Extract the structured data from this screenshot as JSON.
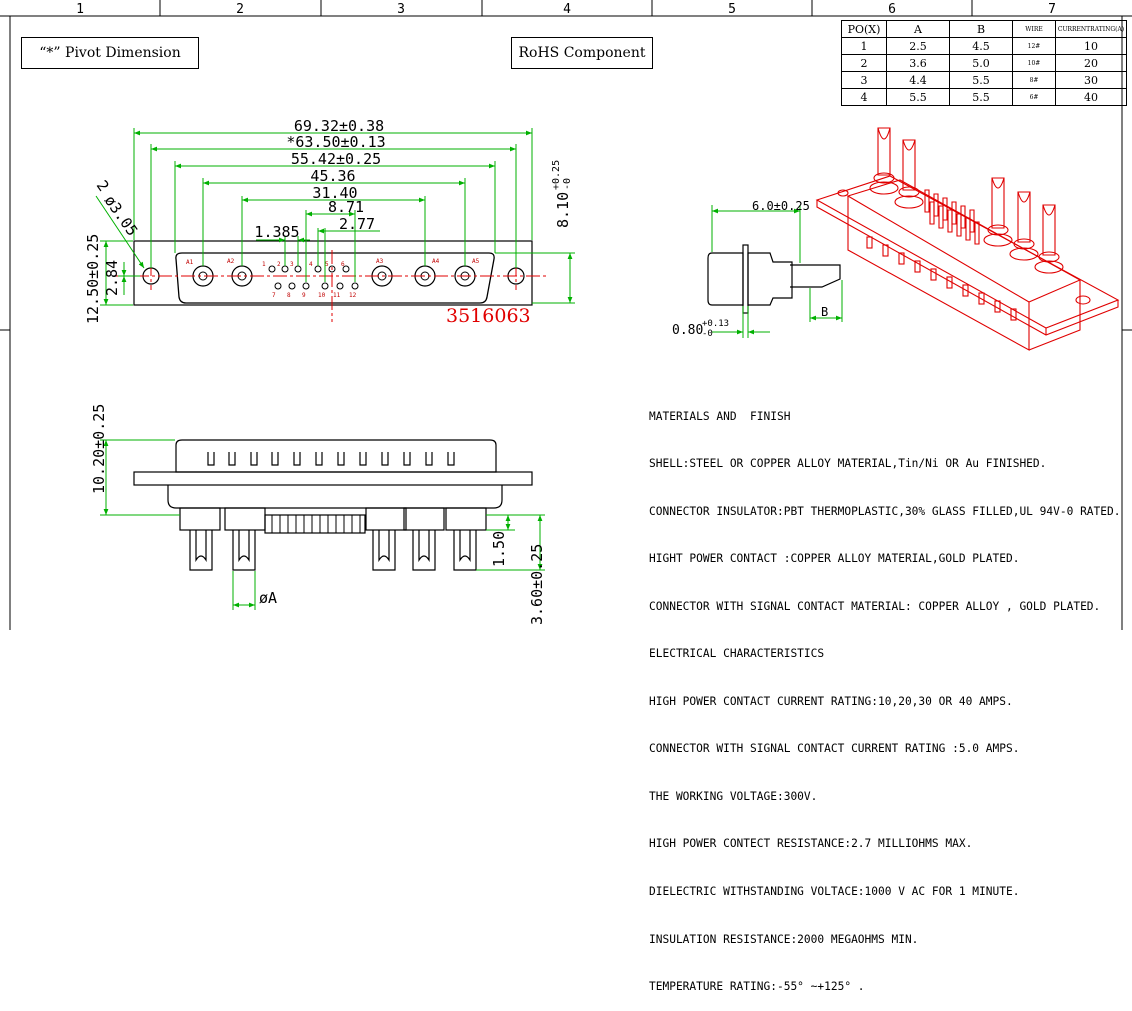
{
  "sheet": {
    "column_numbers": [
      "1",
      "2",
      "3",
      "4",
      "5",
      "6",
      "7"
    ]
  },
  "labels": {
    "pivot_dimension": "“*” Pivot Dimension",
    "rohs": "RoHS  Component"
  },
  "table": {
    "headers": [
      "PO(X)",
      "A",
      "B",
      "WIRE",
      "CURRENTRATING(A)"
    ],
    "rows": [
      [
        "1",
        "2.5",
        "4.5",
        "12#",
        "10"
      ],
      [
        "2",
        "3.6",
        "5.0",
        "10#",
        "20"
      ],
      [
        "3",
        "4.4",
        "5.5",
        "8#",
        "30"
      ],
      [
        "4",
        "5.5",
        "5.5",
        "6#",
        "40"
      ]
    ]
  },
  "front_view": {
    "dims": {
      "overall": "69.32±0.38",
      "pivot": "*63.50±0.13",
      "shell": "55.42±0.25",
      "d4536": "45.36",
      "d3140": "31.40",
      "d871": "8.71",
      "d277": "2.77",
      "d1385": "1.385",
      "height": "8.10",
      "height_tol_top": "+0.25",
      "height_tol_bot": "-0",
      "hole": "ø3.05",
      "hole_qty": "2",
      "width": "12.50±0.25",
      "d284": "2.84"
    },
    "part_number": "3516063",
    "pin_numbers_top": [
      "1",
      "2",
      "3",
      "4",
      "5",
      "6"
    ],
    "pin_numbers_bottom": [
      "7",
      "8",
      "9",
      "10",
      "11",
      "12"
    ],
    "contact_marks": [
      "A1",
      "A2",
      "A3",
      "A4",
      "A5"
    ]
  },
  "side_view": {
    "dims": {
      "depth": "6.0±0.25",
      "flange_base": "0.80",
      "flange_tol_top": "+0.13",
      "flange_tol_bot": "-0",
      "b": "B"
    }
  },
  "bottom_view": {
    "dims": {
      "height": "10.20±0.25",
      "pin_offset": "1.50",
      "pin_length": "3.60±0.25",
      "diameter": "øA"
    }
  },
  "notes": [
    "MATERIALS AND  FINISH",
    "SHELL:STEEL OR COPPER ALLOY MATERIAL,Tin/Ni OR Au FINISHED.",
    "CONNECTOR INSULATOR:PBT THERMOPLASTIC,30% GLASS FILLED,UL 94V-0 RATED.",
    "HIGHT POWER CONTACT :COPPER ALLOY MATERIAL,GOLD PLATED.",
    "CONNECTOR WITH SIGNAL CONTACT MATERIAL: COPPER ALLOY , GOLD PLATED.",
    "ELECTRICAL CHARACTERISTICS",
    "HIGH POWER CONTACT CURRENT RATING:10,20,30 OR 40 AMPS.",
    "CONNECTOR WITH SIGNAL CONTACT CURRENT RATING :5.0 AMPS.",
    "THE WORKING VOLTAGE:300V.",
    "HIGH POWER CONTECT RESISTANCE:2.7 MILLIOHMS MAX.",
    "DIELECTRIC WITHSTANDING VOLTACE:1000 V AC FOR 1 MINUTE.",
    "INSULATION RESISTANCE:2000 MEGAOHMS MIN.",
    "TEMPERATURE RATING:-55° ~+125° ."
  ],
  "colors": {
    "dimension": "#00b000",
    "centerline": "#e00000",
    "render": "#e00000",
    "outline": "#000000"
  }
}
